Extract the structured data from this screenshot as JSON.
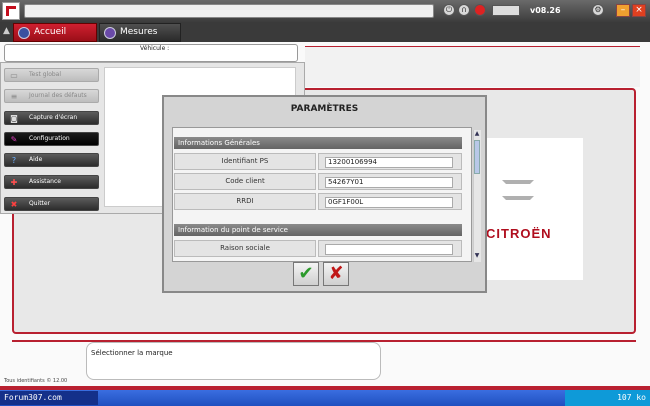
{
  "header": {
    "version": "v08.26",
    "tabs": [
      {
        "label": "Accueil"
      },
      {
        "label": "Mesures"
      }
    ]
  },
  "vehicle_label": "Véhicule :",
  "menu": {
    "items": [
      {
        "label": "Test global",
        "icon": "car-test-icon"
      },
      {
        "label": "Journal des défauts",
        "icon": "log-icon"
      },
      {
        "label": "Capture d'écran",
        "icon": "camera-icon"
      },
      {
        "label": "Configuration",
        "icon": "config-icon"
      },
      {
        "label": "Aide",
        "icon": "help-icon"
      },
      {
        "label": "Assistance",
        "icon": "assistance-icon"
      },
      {
        "label": "Quitter",
        "icon": "close-icon"
      }
    ]
  },
  "brand": {
    "logo_text": "CITROËN"
  },
  "dialog": {
    "title": "PARAMÈTRES",
    "sections": [
      {
        "title": "Informations Générales",
        "rows": [
          {
            "label": "Identifiant PS",
            "value": "13200106994"
          },
          {
            "label": "Code client",
            "value": "54267Y01"
          },
          {
            "label": "RRDI",
            "value": "0GF1F00L"
          }
        ]
      },
      {
        "title": "Information du point de service",
        "rows": [
          {
            "label": "Raison sociale",
            "value": ""
          }
        ]
      }
    ],
    "ok_symbol": "✔",
    "cancel_symbol": "✘"
  },
  "status": {
    "message": "Sélectionner la marque",
    "footer": "Tous identifiants © 12.00"
  },
  "taskbar": {
    "left_text": "Forum307.com",
    "right_text": "107 ko"
  },
  "colors": {
    "accent_red": "#b82030",
    "tab_active": "#d02030",
    "ok_green": "#2c9a2c",
    "cancel_red": "#c01818"
  }
}
